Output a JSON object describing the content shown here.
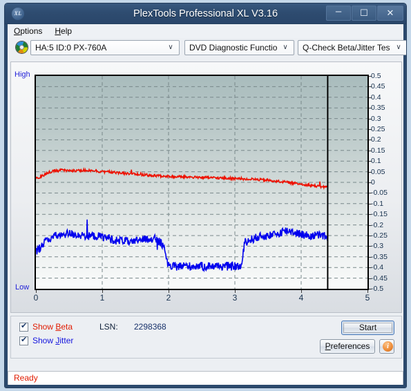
{
  "window": {
    "title": "PlexTools Professional XL V3.16",
    "app_icon": "XL",
    "buttons": {
      "minimize": "–",
      "maximize": "☐",
      "close": "✕"
    }
  },
  "menubar": {
    "items": [
      {
        "label": "Options",
        "accel": "O"
      },
      {
        "label": "Help",
        "accel": "H"
      }
    ]
  },
  "toolbar": {
    "drive_select": "HA:5 ID:0  PX-760A",
    "function_select": "DVD Diagnostic Functions",
    "test_select": "Q-Check Beta/Jitter Test",
    "arrow": "∨"
  },
  "chart_labels": {
    "high": "High",
    "low": "Low"
  },
  "options": {
    "show_beta": {
      "label": "Show Beta",
      "checked": true,
      "color": "#e01b00"
    },
    "show_jitter": {
      "label": "Show Jitter",
      "checked": true,
      "color": "#1414dd"
    },
    "lsn_label": "LSN:",
    "lsn_value": "2298368",
    "start_button": "Start",
    "preferences_button": "Preferences",
    "info_button": "i"
  },
  "status": {
    "text": "Ready",
    "color": "#e01b00"
  },
  "chart_data": {
    "type": "line",
    "title": "Q-Check Beta/Jitter Test",
    "xlabel": "",
    "ylabel": "",
    "xlim": [
      0,
      5
    ],
    "ylim": [
      -0.5,
      0.5
    ],
    "xticks": [
      0,
      1,
      2,
      3,
      4,
      5
    ],
    "yticks": [
      0.5,
      0.45,
      0.4,
      0.35,
      0.3,
      0.25,
      0.2,
      0.15,
      0.1,
      0.05,
      0,
      -0.05,
      -0.1,
      -0.15,
      -0.2,
      -0.25,
      -0.3,
      -0.35,
      -0.4,
      -0.45,
      -0.5
    ],
    "grid": true,
    "legend_position": "bottom-left",
    "data_end_marker_x": 4.4,
    "series": [
      {
        "name": "Show Beta",
        "color": "#ee1100",
        "x": [
          0.0,
          0.05,
          0.1,
          0.15,
          0.2,
          0.25,
          0.3,
          0.35,
          0.4,
          0.45,
          0.5,
          0.55,
          0.6,
          0.65,
          0.7,
          0.75,
          0.8,
          0.85,
          0.9,
          0.95,
          1.0,
          1.05,
          1.1,
          1.15,
          1.2,
          1.25,
          1.3,
          1.35,
          1.4,
          1.45,
          1.5,
          1.55,
          1.6,
          1.65,
          1.7,
          1.75,
          1.8,
          1.85,
          1.9,
          1.95,
          2.0,
          2.05,
          2.1,
          2.15,
          2.2,
          2.25,
          2.3,
          2.35,
          2.4,
          2.45,
          2.5,
          2.55,
          2.6,
          2.65,
          2.7,
          2.75,
          2.8,
          2.85,
          2.9,
          2.95,
          3.0,
          3.05,
          3.1,
          3.15,
          3.2,
          3.25,
          3.3,
          3.35,
          3.4,
          3.45,
          3.5,
          3.55,
          3.6,
          3.65,
          3.7,
          3.75,
          3.8,
          3.85,
          3.9,
          3.95,
          4.0,
          4.05,
          4.1,
          4.15,
          4.2,
          4.25,
          4.3,
          4.35,
          4.4
        ],
        "y": [
          0.02,
          0.024,
          0.03,
          0.04,
          0.048,
          0.052,
          0.055,
          0.056,
          0.058,
          0.057,
          0.056,
          0.055,
          0.054,
          0.056,
          0.057,
          0.056,
          0.055,
          0.054,
          0.053,
          0.052,
          0.051,
          0.05,
          0.049,
          0.048,
          0.046,
          0.045,
          0.044,
          0.042,
          0.041,
          0.04,
          0.038,
          0.037,
          0.036,
          0.035,
          0.034,
          0.033,
          0.032,
          0.031,
          0.03,
          0.029,
          0.028,
          0.028,
          0.027,
          0.027,
          0.026,
          0.026,
          0.025,
          0.025,
          0.024,
          0.024,
          0.023,
          0.023,
          0.022,
          0.022,
          0.021,
          0.021,
          0.02,
          0.02,
          0.019,
          0.019,
          0.018,
          0.018,
          0.017,
          0.016,
          0.016,
          0.015,
          0.014,
          0.013,
          0.012,
          0.011,
          0.01,
          0.008,
          0.007,
          0.005,
          0.004,
          0.002,
          0.0,
          -0.002,
          -0.004,
          -0.006,
          -0.008,
          -0.01,
          -0.012,
          -0.014,
          -0.016,
          -0.018,
          -0.02,
          -0.021,
          -0.022
        ]
      },
      {
        "name": "Show Jitter",
        "color": "#0000ee",
        "x": [
          0.0,
          0.05,
          0.1,
          0.15,
          0.2,
          0.25,
          0.3,
          0.35,
          0.4,
          0.45,
          0.5,
          0.55,
          0.6,
          0.65,
          0.7,
          0.75,
          0.8,
          0.85,
          0.9,
          0.95,
          1.0,
          1.05,
          1.1,
          1.15,
          1.2,
          1.25,
          1.3,
          1.35,
          1.4,
          1.45,
          1.5,
          1.55,
          1.6,
          1.65,
          1.7,
          1.75,
          1.8,
          1.85,
          1.9,
          1.95,
          2.0,
          2.05,
          2.1,
          2.15,
          2.2,
          2.25,
          2.3,
          2.35,
          2.4,
          2.45,
          2.5,
          2.55,
          2.6,
          2.65,
          2.7,
          2.75,
          2.8,
          2.85,
          2.9,
          2.95,
          3.0,
          3.05,
          3.1,
          3.15,
          3.2,
          3.25,
          3.3,
          3.35,
          3.4,
          3.45,
          3.5,
          3.55,
          3.6,
          3.65,
          3.7,
          3.75,
          3.8,
          3.85,
          3.9,
          3.95,
          4.0,
          4.05,
          4.1,
          4.15,
          4.2,
          4.25,
          4.3,
          4.35,
          4.4
        ],
        "y": [
          -0.33,
          -0.31,
          -0.29,
          -0.275,
          -0.265,
          -0.258,
          -0.252,
          -0.248,
          -0.245,
          -0.242,
          -0.24,
          -0.243,
          -0.245,
          -0.247,
          -0.248,
          -0.25,
          -0.251,
          -0.252,
          -0.253,
          -0.254,
          -0.256,
          -0.258,
          -0.262,
          -0.268,
          -0.272,
          -0.276,
          -0.27,
          -0.274,
          -0.282,
          -0.288,
          -0.278,
          -0.268,
          -0.266,
          -0.27,
          -0.264,
          -0.262,
          -0.268,
          -0.278,
          -0.29,
          -0.33,
          -0.395,
          -0.398,
          -0.396,
          -0.394,
          -0.393,
          -0.392,
          -0.394,
          -0.395,
          -0.393,
          -0.392,
          -0.394,
          -0.396,
          -0.393,
          -0.392,
          -0.394,
          -0.395,
          -0.393,
          -0.394,
          -0.396,
          -0.395,
          -0.394,
          -0.396,
          -0.395,
          -0.28,
          -0.275,
          -0.268,
          -0.262,
          -0.258,
          -0.255,
          -0.252,
          -0.25,
          -0.248,
          -0.246,
          -0.245,
          -0.232,
          -0.228,
          -0.226,
          -0.23,
          -0.234,
          -0.238,
          -0.244,
          -0.248,
          -0.25,
          -0.252,
          -0.25,
          -0.248,
          -0.25,
          -0.252,
          -0.254
        ]
      }
    ],
    "noise": {
      "Show Beta": 0.006,
      "Show Jitter": 0.02
    }
  }
}
